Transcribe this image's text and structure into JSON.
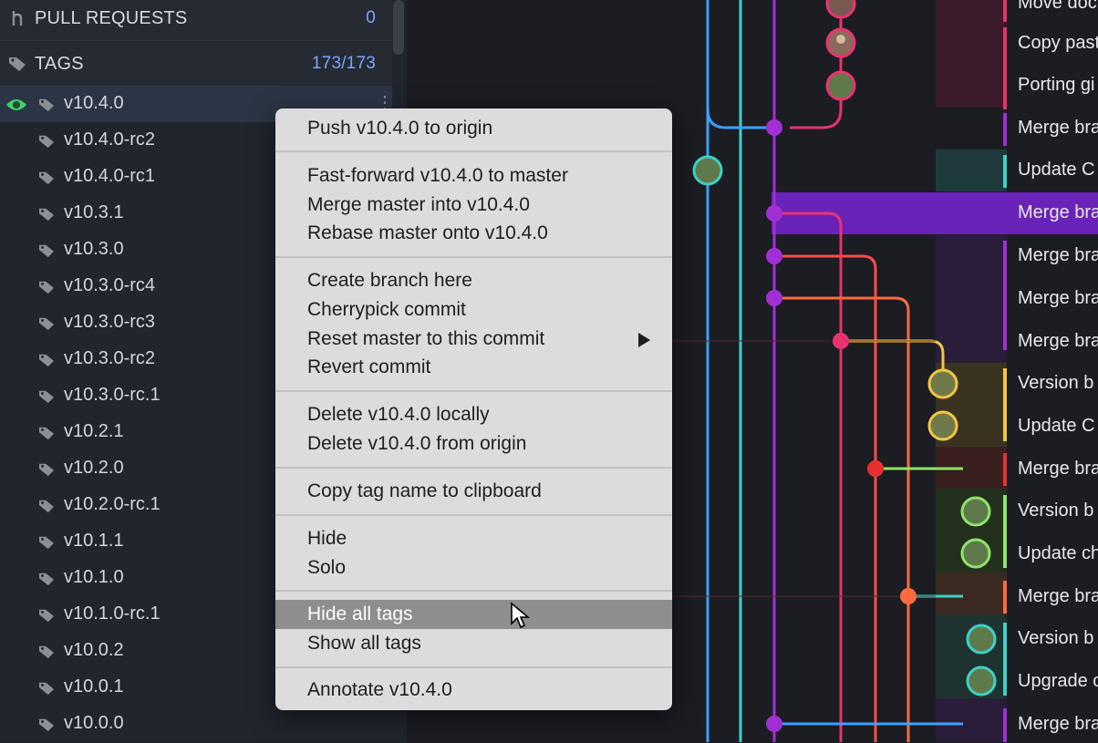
{
  "sidebar": {
    "pull_requests": {
      "label": "PULL REQUESTS",
      "count": "0"
    },
    "tags": {
      "label": "TAGS",
      "count": "173/173"
    },
    "tag_items": [
      "v10.4.0",
      "v10.4.0-rc2",
      "v10.4.0-rc1",
      "v10.3.1",
      "v10.3.0",
      "v10.3.0-rc4",
      "v10.3.0-rc3",
      "v10.3.0-rc2",
      "v10.3.0-rc.1",
      "v10.2.1",
      "v10.2.0",
      "v10.2.0-rc.1",
      "v10.1.1",
      "v10.1.0",
      "v10.1.0-rc.1",
      "v10.0.2",
      "v10.0.1",
      "v10.0.0"
    ]
  },
  "context_menu": {
    "items": [
      "Push v10.4.0 to origin",
      "Fast-forward v10.4.0 to master",
      "Merge master into v10.4.0",
      "Rebase master onto v10.4.0",
      "Create branch here",
      "Cherrypick commit",
      "Reset master to this commit",
      "Revert commit",
      "Delete v10.4.0 locally",
      "Delete v10.4.0 from origin",
      "Copy tag name to clipboard",
      "Hide",
      "Solo",
      "Hide all tags",
      "Show all tags",
      "Annotate v10.4.0"
    ],
    "highlighted": "Hide all tags"
  },
  "commits": [
    "Move doc",
    "Copy past",
    "Porting gi",
    "Merge bra",
    "Update C",
    "Merge bra",
    "Merge bra",
    "Merge bra",
    "Merge bra",
    "Version b",
    "Update C",
    "Merge bra",
    "Version b",
    "Update ch",
    "Merge bra",
    "Version b",
    "Upgrade c",
    "Merge bra"
  ],
  "colors": {
    "accent_selected_row": "#6a23b8",
    "lane_blue": "#3aa0ff",
    "lane_teal": "#3fd0c8",
    "lane_purple": "#a12fd6",
    "lane_pink": "#e8336f",
    "lane_orange": "#ff6b3d",
    "lane_yellow": "#f5c542",
    "lane_green": "#8fe36a"
  }
}
